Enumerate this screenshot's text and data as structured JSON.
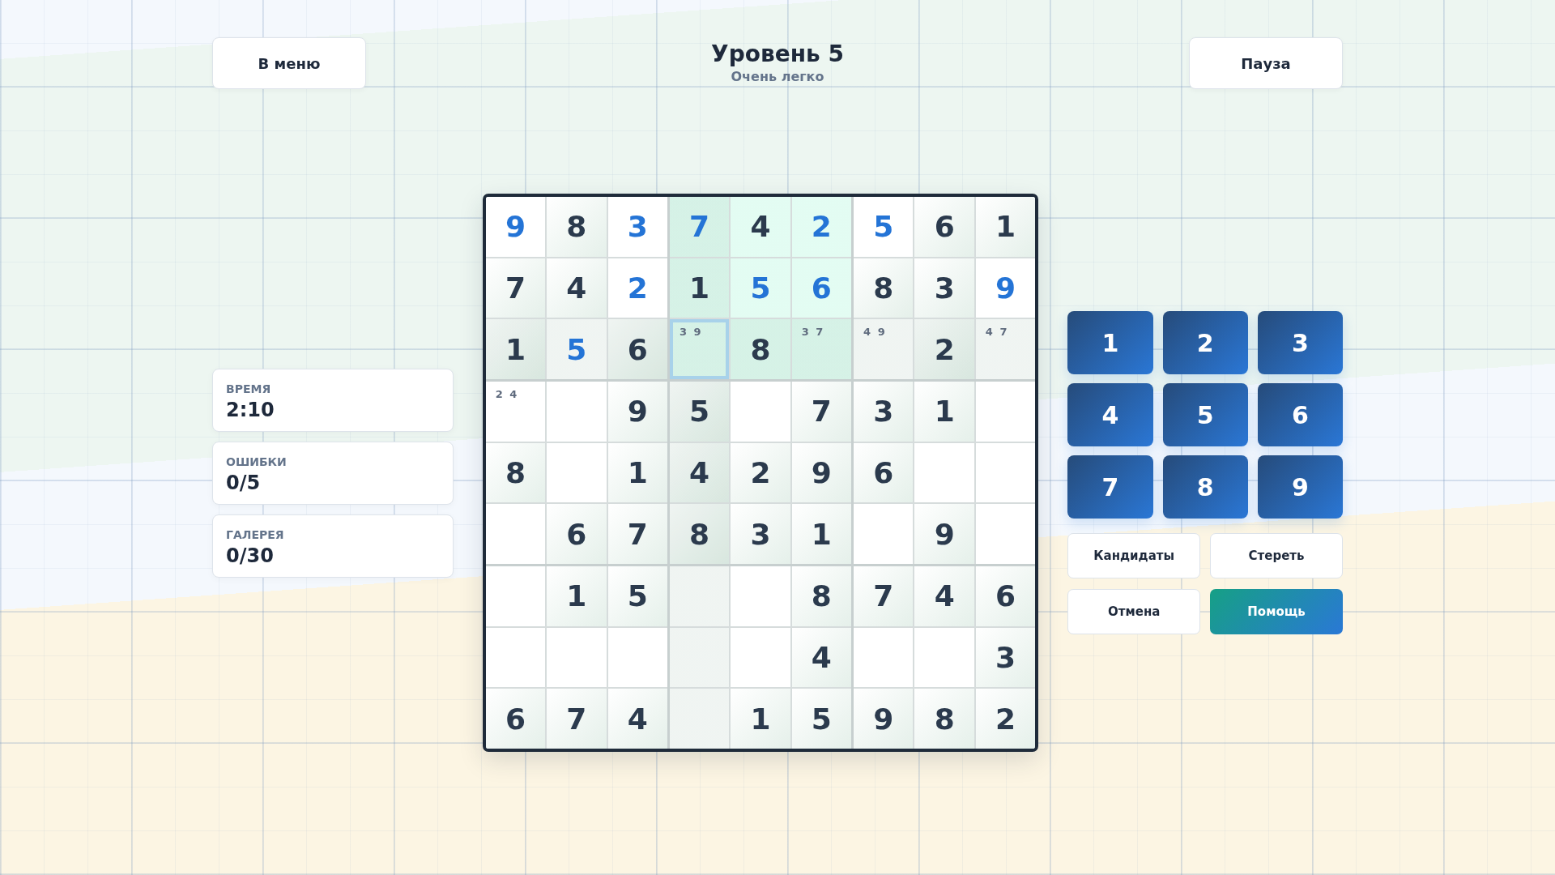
{
  "header": {
    "menu_button": "В меню",
    "title": "Уровень 5",
    "subtitle": "Очень легко",
    "pause_button": "Пауза"
  },
  "stats": [
    {
      "label": "ВРЕМЯ",
      "value": "2:10"
    },
    {
      "label": "ОШИБКИ",
      "value": "0/5"
    },
    {
      "label": "ГАЛЕРЕЯ",
      "value": "0/30"
    }
  ],
  "board": {
    "rows": [
      {
        "cells": [
          {
            "kind": "entered",
            "value": "9",
            "in_box": false,
            "in_line": false,
            "selected": false
          },
          {
            "kind": "given",
            "value": "8",
            "in_box": false,
            "in_line": false,
            "selected": false
          },
          {
            "kind": "entered",
            "value": "3",
            "in_box": false,
            "in_line": false,
            "selected": false
          },
          {
            "kind": "entered",
            "value": "7",
            "in_box": true,
            "in_line": true,
            "selected": false
          },
          {
            "kind": "given",
            "value": "4",
            "in_box": true,
            "in_line": false,
            "selected": false
          },
          {
            "kind": "entered",
            "value": "2",
            "in_box": true,
            "in_line": false,
            "selected": false
          },
          {
            "kind": "entered",
            "value": "5",
            "in_box": false,
            "in_line": false,
            "selected": false
          },
          {
            "kind": "given",
            "value": "6",
            "in_box": false,
            "in_line": false,
            "selected": false
          },
          {
            "kind": "given",
            "value": "1",
            "in_box": false,
            "in_line": false,
            "selected": false
          }
        ]
      },
      {
        "cells": [
          {
            "kind": "given",
            "value": "7",
            "in_box": false,
            "in_line": false,
            "selected": false
          },
          {
            "kind": "given",
            "value": "4",
            "in_box": false,
            "in_line": false,
            "selected": false
          },
          {
            "kind": "entered",
            "value": "2",
            "in_box": false,
            "in_line": false,
            "selected": false
          },
          {
            "kind": "given",
            "value": "1",
            "in_box": true,
            "in_line": true,
            "selected": false
          },
          {
            "kind": "entered",
            "value": "5",
            "in_box": true,
            "in_line": false,
            "selected": false
          },
          {
            "kind": "entered",
            "value": "6",
            "in_box": true,
            "in_line": false,
            "selected": false
          },
          {
            "kind": "given",
            "value": "8",
            "in_box": false,
            "in_line": false,
            "selected": false
          },
          {
            "kind": "given",
            "value": "3",
            "in_box": false,
            "in_line": false,
            "selected": false
          },
          {
            "kind": "entered",
            "value": "9",
            "in_box": false,
            "in_line": false,
            "selected": false
          }
        ]
      },
      {
        "cells": [
          {
            "kind": "given",
            "value": "1",
            "in_box": false,
            "in_line": true,
            "selected": false
          },
          {
            "kind": "entered",
            "value": "5",
            "in_box": false,
            "in_line": true,
            "selected": false
          },
          {
            "kind": "given",
            "value": "6",
            "in_box": false,
            "in_line": true,
            "selected": false
          },
          {
            "kind": "notes",
            "value": "3 9",
            "in_box": true,
            "in_line": true,
            "selected": true
          },
          {
            "kind": "given",
            "value": "8",
            "in_box": true,
            "in_line": true,
            "selected": false
          },
          {
            "kind": "notes",
            "value": "3 7",
            "in_box": true,
            "in_line": true,
            "selected": false
          },
          {
            "kind": "notes",
            "value": "4 9",
            "in_box": false,
            "in_line": true,
            "selected": false
          },
          {
            "kind": "given",
            "value": "2",
            "in_box": false,
            "in_line": true,
            "selected": false
          },
          {
            "kind": "notes",
            "value": "4 7",
            "in_box": false,
            "in_line": true,
            "selected": false
          }
        ]
      },
      {
        "cells": [
          {
            "kind": "notes",
            "value": "2 4",
            "in_box": false,
            "in_line": false,
            "selected": false
          },
          {
            "kind": "empty",
            "in_box": false,
            "in_line": false,
            "selected": false
          },
          {
            "kind": "given",
            "value": "9",
            "in_box": false,
            "in_line": false,
            "selected": false
          },
          {
            "kind": "given",
            "value": "5",
            "in_box": false,
            "in_line": true,
            "selected": false
          },
          {
            "kind": "empty",
            "in_box": false,
            "in_line": false,
            "selected": false
          },
          {
            "kind": "given",
            "value": "7",
            "in_box": false,
            "in_line": false,
            "selected": false
          },
          {
            "kind": "given",
            "value": "3",
            "in_box": false,
            "in_line": false,
            "selected": false
          },
          {
            "kind": "given",
            "value": "1",
            "in_box": false,
            "in_line": false,
            "selected": false
          },
          {
            "kind": "empty",
            "in_box": false,
            "in_line": false,
            "selected": false
          }
        ]
      },
      {
        "cells": [
          {
            "kind": "given",
            "value": "8",
            "in_box": false,
            "in_line": false,
            "selected": false
          },
          {
            "kind": "empty",
            "in_box": false,
            "in_line": false,
            "selected": false
          },
          {
            "kind": "given",
            "value": "1",
            "in_box": false,
            "in_line": false,
            "selected": false
          },
          {
            "kind": "given",
            "value": "4",
            "in_box": false,
            "in_line": true,
            "selected": false
          },
          {
            "kind": "given",
            "value": "2",
            "in_box": false,
            "in_line": false,
            "selected": false
          },
          {
            "kind": "given",
            "value": "9",
            "in_box": false,
            "in_line": false,
            "selected": false
          },
          {
            "kind": "given",
            "value": "6",
            "in_box": false,
            "in_line": false,
            "selected": false
          },
          {
            "kind": "empty",
            "in_box": false,
            "in_line": false,
            "selected": false
          },
          {
            "kind": "empty",
            "in_box": false,
            "in_line": false,
            "selected": false
          }
        ]
      },
      {
        "cells": [
          {
            "kind": "empty",
            "in_box": false,
            "in_line": false,
            "selected": false
          },
          {
            "kind": "given",
            "value": "6",
            "in_box": false,
            "in_line": false,
            "selected": false
          },
          {
            "kind": "given",
            "value": "7",
            "in_box": false,
            "in_line": false,
            "selected": false
          },
          {
            "kind": "given",
            "value": "8",
            "in_box": false,
            "in_line": true,
            "selected": false
          },
          {
            "kind": "given",
            "value": "3",
            "in_box": false,
            "in_line": false,
            "selected": false
          },
          {
            "kind": "given",
            "value": "1",
            "in_box": false,
            "in_line": false,
            "selected": false
          },
          {
            "kind": "empty",
            "in_box": false,
            "in_line": false,
            "selected": false
          },
          {
            "kind": "given",
            "value": "9",
            "in_box": false,
            "in_line": false,
            "selected": false
          },
          {
            "kind": "empty",
            "in_box": false,
            "in_line": false,
            "selected": false
          }
        ]
      },
      {
        "cells": [
          {
            "kind": "empty",
            "in_box": false,
            "in_line": false,
            "selected": false
          },
          {
            "kind": "given",
            "value": "1",
            "in_box": false,
            "in_line": false,
            "selected": false
          },
          {
            "kind": "given",
            "value": "5",
            "in_box": false,
            "in_line": false,
            "selected": false
          },
          {
            "kind": "empty",
            "in_box": false,
            "in_line": true,
            "selected": false
          },
          {
            "kind": "empty",
            "in_box": false,
            "in_line": false,
            "selected": false
          },
          {
            "kind": "given",
            "value": "8",
            "in_box": false,
            "in_line": false,
            "selected": false
          },
          {
            "kind": "given",
            "value": "7",
            "in_box": false,
            "in_line": false,
            "selected": false
          },
          {
            "kind": "given",
            "value": "4",
            "in_box": false,
            "in_line": false,
            "selected": false
          },
          {
            "kind": "given",
            "value": "6",
            "in_box": false,
            "in_line": false,
            "selected": false
          }
        ]
      },
      {
        "cells": [
          {
            "kind": "empty",
            "in_box": false,
            "in_line": false,
            "selected": false
          },
          {
            "kind": "empty",
            "in_box": false,
            "in_line": false,
            "selected": false
          },
          {
            "kind": "empty",
            "in_box": false,
            "in_line": false,
            "selected": false
          },
          {
            "kind": "empty",
            "in_box": false,
            "in_line": true,
            "selected": false
          },
          {
            "kind": "empty",
            "in_box": false,
            "in_line": false,
            "selected": false
          },
          {
            "kind": "given",
            "value": "4",
            "in_box": false,
            "in_line": false,
            "selected": false
          },
          {
            "kind": "empty",
            "in_box": false,
            "in_line": false,
            "selected": false
          },
          {
            "kind": "empty",
            "in_box": false,
            "in_line": false,
            "selected": false
          },
          {
            "kind": "given",
            "value": "3",
            "in_box": false,
            "in_line": false,
            "selected": false
          }
        ]
      },
      {
        "cells": [
          {
            "kind": "given",
            "value": "6",
            "in_box": false,
            "in_line": false,
            "selected": false
          },
          {
            "kind": "given",
            "value": "7",
            "in_box": false,
            "in_line": false,
            "selected": false
          },
          {
            "kind": "given",
            "value": "4",
            "in_box": false,
            "in_line": false,
            "selected": false
          },
          {
            "kind": "empty",
            "in_box": false,
            "in_line": true,
            "selected": false
          },
          {
            "kind": "given",
            "value": "1",
            "in_box": false,
            "in_line": false,
            "selected": false
          },
          {
            "kind": "given",
            "value": "5",
            "in_box": false,
            "in_line": false,
            "selected": false
          },
          {
            "kind": "given",
            "value": "9",
            "in_box": false,
            "in_line": false,
            "selected": false
          },
          {
            "kind": "given",
            "value": "8",
            "in_box": false,
            "in_line": false,
            "selected": false
          },
          {
            "kind": "given",
            "value": "2",
            "in_box": false,
            "in_line": false,
            "selected": false
          }
        ]
      }
    ]
  },
  "keypad": [
    "1",
    "2",
    "3",
    "4",
    "5",
    "6",
    "7",
    "8",
    "9"
  ],
  "actions": [
    {
      "label": "Кандидаты",
      "kind": "plain"
    },
    {
      "label": "Стереть",
      "kind": "plain"
    },
    {
      "label": "Отмена",
      "kind": "plain"
    },
    {
      "label": "Помощь",
      "kind": "accent"
    }
  ]
}
